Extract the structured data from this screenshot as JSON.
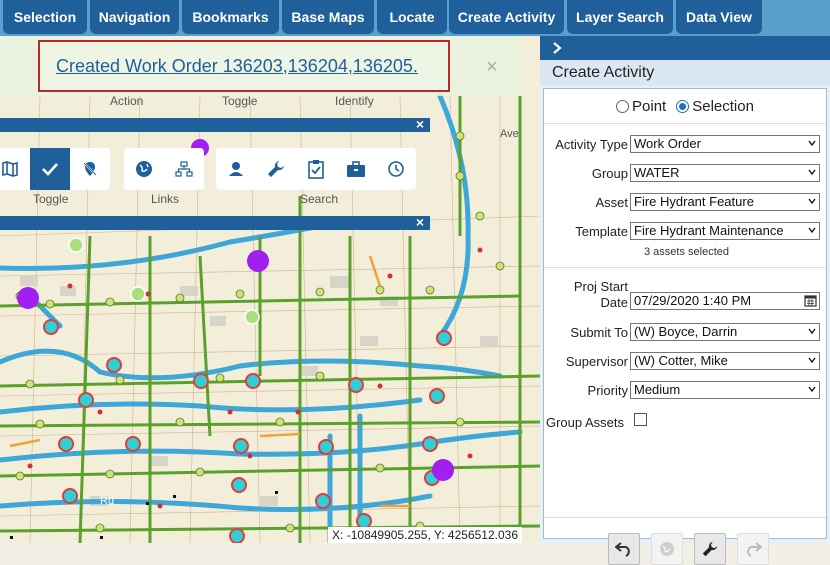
{
  "nav": {
    "items": [
      "Selection",
      "Navigation",
      "Bookmarks",
      "Base Maps",
      "Locate",
      "Create Activity",
      "Layer Search",
      "Data View"
    ]
  },
  "toast": {
    "message": "Created Work Order 136203,136204,136205.",
    "close": "×"
  },
  "map_toolbar": {
    "group_labels_top": [
      "Action",
      "Toggle",
      "Identify"
    ],
    "group_labels_bottom": [
      "Toggle",
      "Links",
      "Search"
    ],
    "close": "×",
    "street_label": "Ave",
    "street_label2": "Rd"
  },
  "coords": "X: -10849905.255, Y: 4256512.036",
  "panel": {
    "chevron": "›",
    "title": "Create Activity",
    "mode": {
      "point_label": "Point",
      "selection_label": "Selection",
      "selected": "Selection"
    },
    "fields": {
      "activity_type": {
        "label": "Activity Type",
        "value": "Work Order"
      },
      "group": {
        "label": "Group",
        "value": "WATER"
      },
      "asset": {
        "label": "Asset",
        "value": "Fire Hydrant Feature"
      },
      "template": {
        "label": "Template",
        "value": "Fire Hydrant Maintenance"
      },
      "assets_note": "3 assets selected",
      "proj_start": {
        "label_line1": "Proj Start",
        "label_line2": "Date",
        "value": "07/29/2020 1:40 PM"
      },
      "submit_to": {
        "label": "Submit To",
        "value": "(W) Boyce, Darrin"
      },
      "supervisor": {
        "label": "Supervisor",
        "value": "(W) Cotter, Mike"
      },
      "priority": {
        "label": "Priority",
        "value": "Medium"
      },
      "group_assets": {
        "label": "Group Assets",
        "checked": false
      }
    }
  },
  "colors": {
    "nav_button": "#1f5f9a",
    "topbar": "#5aa0cc",
    "water_line": "#3fa6d8",
    "main_line": "#5aa02c",
    "hydrant_selected": "#e03c3c",
    "hydrant_fill": "#2ed0d6",
    "purple_marker": "#a020f0"
  }
}
